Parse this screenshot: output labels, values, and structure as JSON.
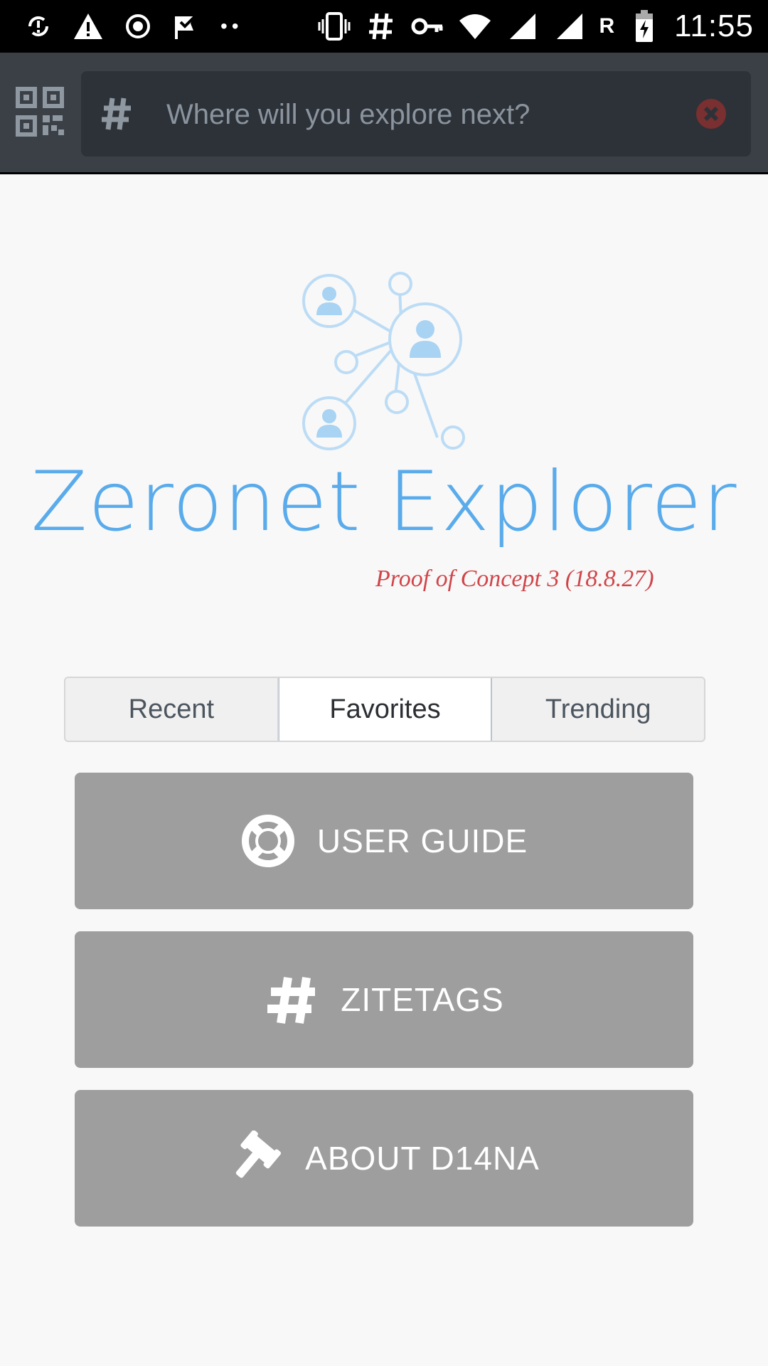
{
  "status_bar": {
    "time": "11:55",
    "roaming_label": "R",
    "left_icons": [
      "sync-alert-icon",
      "warning-icon",
      "record-icon",
      "check-flag-icon"
    ],
    "right_icons": [
      "vibrate-icon",
      "hash-icon",
      "key-icon",
      "wifi-icon",
      "signal-icon",
      "signal-icon",
      "battery-charging-icon"
    ]
  },
  "search": {
    "placeholder": "Where will you explore next?",
    "value": "",
    "prefix_icon": "hash-icon",
    "clear_icon": "close-circle-icon",
    "left_icon": "qr-code-icon"
  },
  "logo": {
    "title": "Zeronet Explorer",
    "subtitle": "Proof of Concept 3 (18.8.27)"
  },
  "tabs": [
    {
      "label": "Recent",
      "active": false
    },
    {
      "label": "Favorites",
      "active": true
    },
    {
      "label": "Trending",
      "active": false
    }
  ],
  "buttons": [
    {
      "label": "USER GUIDE",
      "icon": "lifebuoy-icon"
    },
    {
      "label": "ZITETAGS",
      "icon": "hash-icon"
    },
    {
      "label": "ABOUT D14NA",
      "icon": "gavel-icon"
    }
  ],
  "colors": {
    "appbar": "#3b4047",
    "search_box": "#2d3238",
    "logo_blue": "#5aabeb",
    "subtitle_red": "#d0454a",
    "button_gray": "#9e9e9e",
    "clear_red": "#7a2f30"
  }
}
